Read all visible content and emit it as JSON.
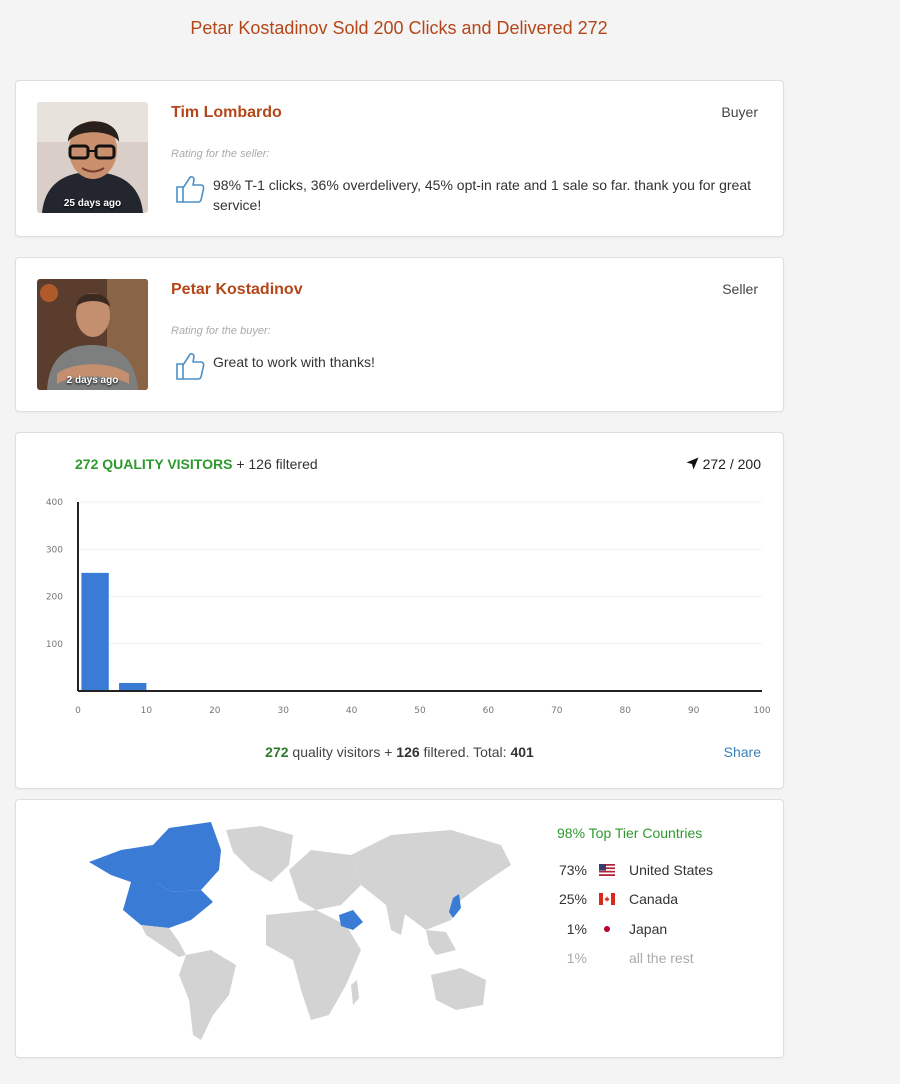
{
  "page_title": "Petar Kostadinov Sold 200 Clicks and Delivered 272",
  "reviews": [
    {
      "name": "Tim Lombardo",
      "role": "Buyer",
      "ago": "25 days ago",
      "rating_label": "Rating for the seller:",
      "thumb_icon": "thumbs-up-icon",
      "comment": "98% T-1 clicks, 36% overdelivery, 45% opt-in rate and 1 sale so far. thank you for great service!"
    },
    {
      "name": "Petar Kostadinov",
      "role": "Seller",
      "ago": "2 days ago",
      "rating_label": "Rating for the buyer:",
      "thumb_icon": "thumbs-up-icon",
      "comment": "Great to work with thanks!"
    }
  ],
  "visitors": {
    "quality_label": "272 QUALITY VISITORS",
    "filtered_label": "+ 126 filtered",
    "counter": "272 / 200",
    "counter_icon": "location-arrow-icon",
    "summary": {
      "quality_num": "272",
      "quality_text": "quality visitors +",
      "filtered_num": "126",
      "filtered_text": "filtered. Total:",
      "total": "401"
    },
    "share_label": "Share"
  },
  "chart_data": {
    "type": "bar",
    "x": [
      2.5,
      8
    ],
    "values": [
      250,
      17
    ],
    "xlim": [
      0,
      100
    ],
    "ylim": [
      0,
      400
    ],
    "xticks": [
      0,
      10,
      20,
      30,
      40,
      50,
      60,
      70,
      80,
      90,
      100
    ],
    "yticks": [
      100,
      200,
      300,
      400
    ],
    "grid": true,
    "bar_color": "#3a7bd5"
  },
  "geo": {
    "headline": "98% Top Tier Countries",
    "countries": [
      {
        "pct": "73%",
        "name": "United States",
        "flag": "us-flag-icon"
      },
      {
        "pct": "25%",
        "name": "Canada",
        "flag": "canada-flag-icon"
      },
      {
        "pct": "1%",
        "name": "Japan",
        "flag": "japan-flag-icon"
      }
    ],
    "rest": {
      "pct": "1%",
      "name": "all the rest"
    },
    "map_highlight_color": "#3a7bd5",
    "map_base_color": "#d3d3d3"
  }
}
